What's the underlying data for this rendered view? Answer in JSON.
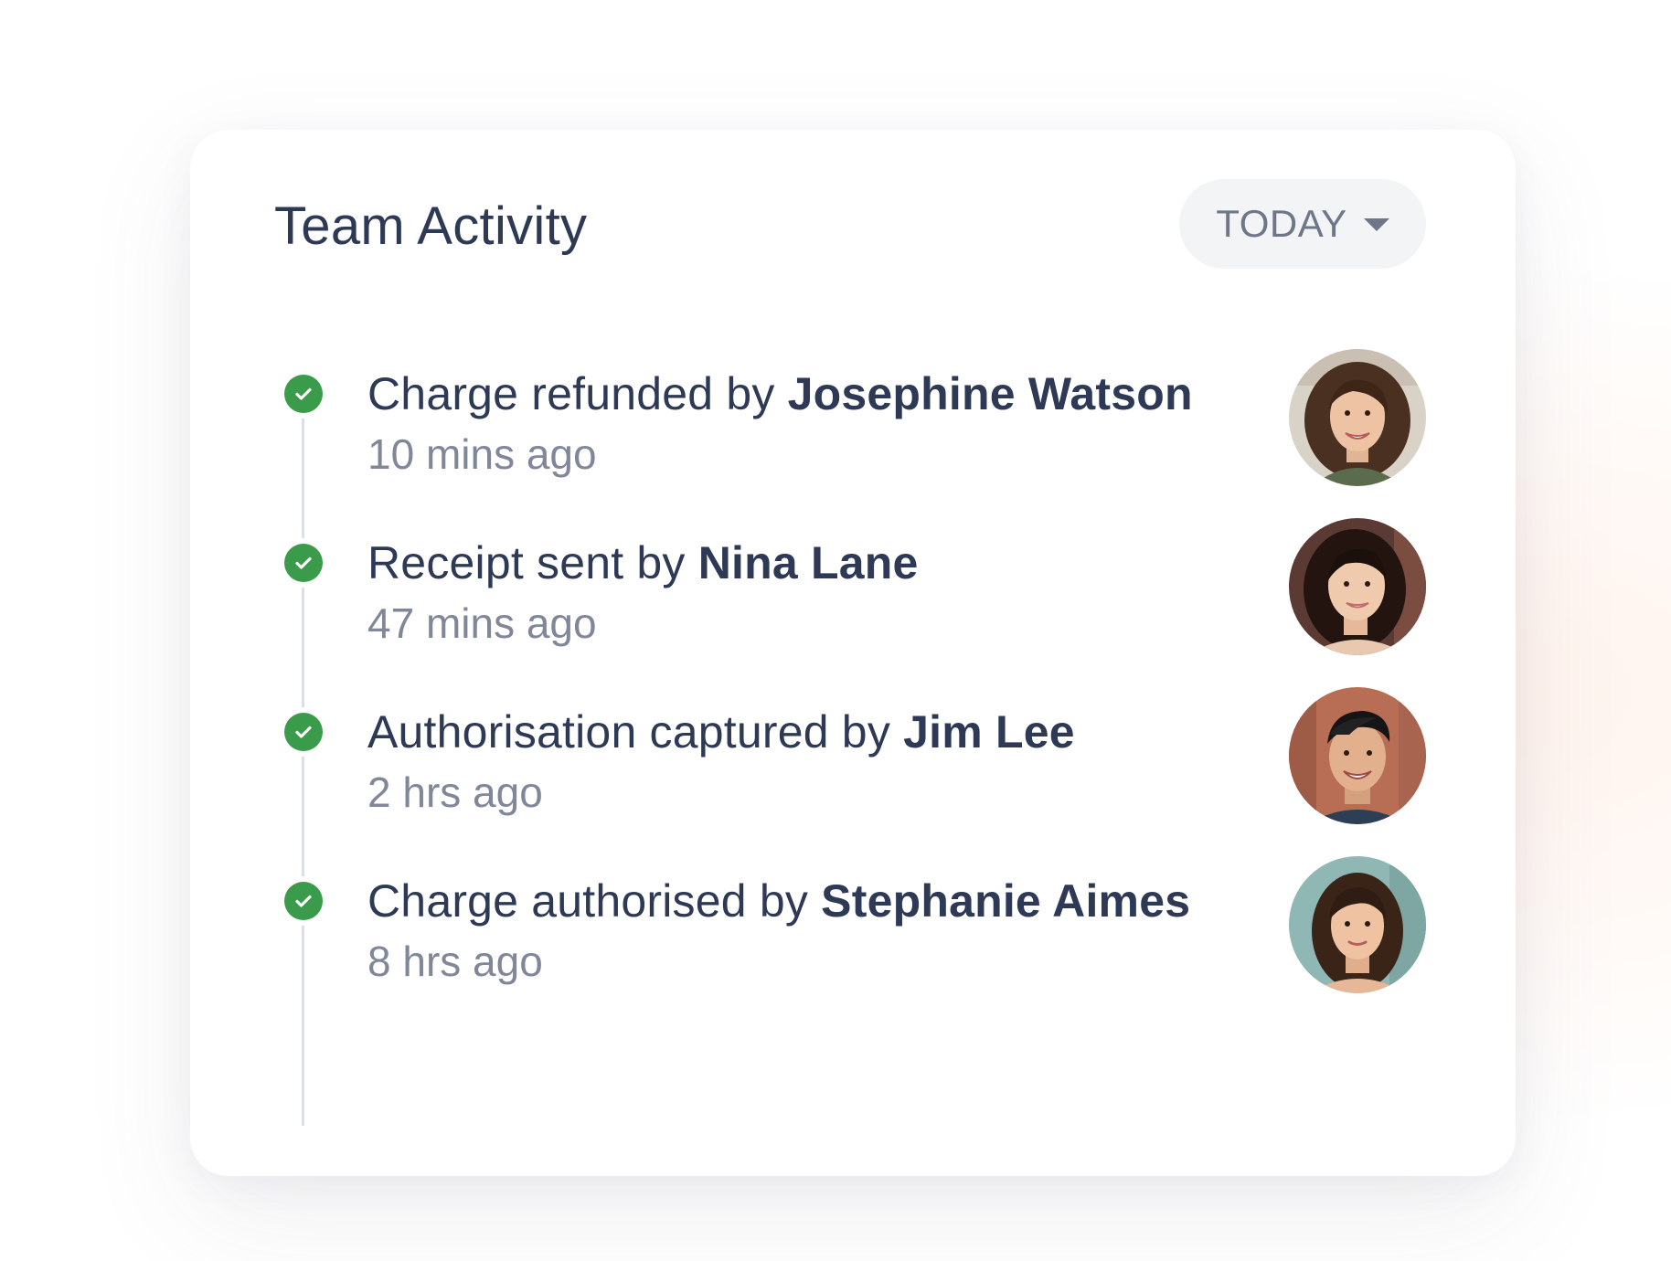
{
  "card": {
    "title": "Team Activity",
    "filter": {
      "selected": "TODAY"
    }
  },
  "activities": [
    {
      "action": "Charge refunded by",
      "name": "Josephine Watson",
      "time": "10 mins ago"
    },
    {
      "action": "Receipt sent by",
      "name": "Nina Lane",
      "time": "47 mins ago"
    },
    {
      "action": "Authorisation captured by",
      "name": "Jim Lee",
      "time": "2 hrs ago"
    },
    {
      "action": "Charge authorised by",
      "name": "Stephanie Aimes",
      "time": "8 hrs ago"
    }
  ],
  "colors": {
    "check": "#3a9b4a",
    "text_primary": "#2e3a55",
    "text_secondary": "#7f8799",
    "button_bg": "#f3f4f6"
  },
  "icons": {
    "status": "check-circle-icon",
    "dropdown": "chevron-down-icon"
  }
}
